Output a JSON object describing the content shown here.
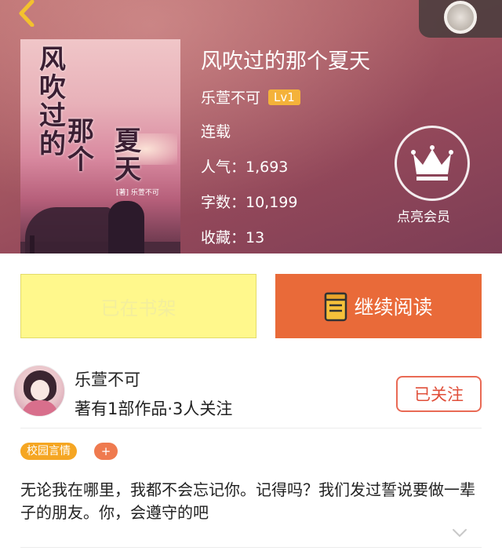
{
  "book": {
    "title": "风吹过的那个夏天",
    "author": "乐萱不可",
    "level": "Lv1",
    "status": "连载",
    "popularity": "人气：1,693",
    "word_count": "字数：10,199",
    "favorites": "收藏：13"
  },
  "cover": {
    "title_col1": "风吹过的",
    "title_col2": "那个",
    "title_col3": "夏天",
    "credit": "[著] 乐萱不可"
  },
  "vip": {
    "label": "点亮会员"
  },
  "actions": {
    "shelf_label": "已在书架",
    "read_label": "继续阅读"
  },
  "author_card": {
    "name": "乐萱不可",
    "stats": "著有1部作品·3人关注",
    "follow_label": "已关注"
  },
  "tags": [
    {
      "label": "校园言情"
    }
  ],
  "tag_add": "+",
  "synopsis": "无论我在哪里，我都不会忘记你。记得吗？我们发过誓说要做一辈子的朋友。你，会遵守的吧",
  "colors": {
    "accent_orange": "#e96a39",
    "shelf_yellow": "#fff88c",
    "tag_orange": "#f5a623",
    "level_badge": "#f4b23a"
  },
  "icons": {
    "back": "chevron-left-icon",
    "vip": "crown-icon",
    "read": "book-icon",
    "expand": "chevron-down-icon"
  }
}
